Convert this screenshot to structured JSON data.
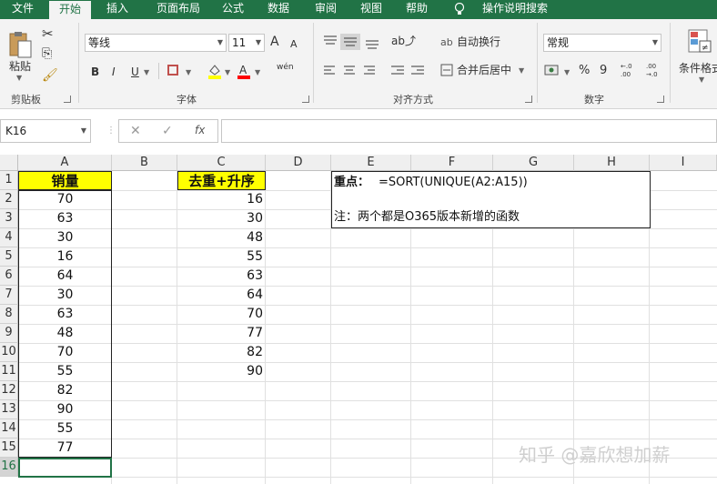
{
  "ribbon_tabs": [
    "文件",
    "开始",
    "插入",
    "页面布局",
    "公式",
    "数据",
    "审阅",
    "视图",
    "帮助",
    "操作说明搜索"
  ],
  "clipboard": {
    "paste": "粘贴",
    "group": "剪贴板"
  },
  "font": {
    "name": "等线",
    "size": "11",
    "bold": "B",
    "italic": "I",
    "underline": "U",
    "grow": "A",
    "shrink": "A",
    "phonetic": "wén",
    "group": "字体"
  },
  "alignment": {
    "wrap": "自动换行",
    "merge": "合并后居中",
    "group": "对齐方式"
  },
  "number": {
    "format": "常规",
    "percent": "%",
    "comma": "9",
    "inc": "←.0 .00",
    "dec": ".00 →.0",
    "group": "数字"
  },
  "styles": {
    "conditional": "条件格式"
  },
  "name_box": "K16",
  "formula_icons": {
    "cancel": "✕",
    "enter": "✓",
    "fx": "fx"
  },
  "columns": [
    "A",
    "B",
    "C",
    "D",
    "E",
    "F",
    "G",
    "H",
    "I"
  ],
  "rows": [
    "1",
    "2",
    "3",
    "4",
    "5",
    "6",
    "7",
    "8",
    "9",
    "10",
    "11",
    "12",
    "13",
    "14",
    "15",
    "16"
  ],
  "col_a_header": "销量",
  "col_a_values": [
    "70",
    "63",
    "30",
    "16",
    "64",
    "30",
    "63",
    "48",
    "70",
    "55",
    "82",
    "90",
    "55",
    "77"
  ],
  "col_c_header": "去重+升序",
  "col_c_values": [
    "16",
    "30",
    "48",
    "55",
    "63",
    "64",
    "70",
    "77",
    "82",
    "90"
  ],
  "note": {
    "label": "重点：",
    "formula": "=SORT(UNIQUE(A2:A15))",
    "remark": "注：两个都是O365版本新增的函数"
  },
  "watermark": "知乎 @嘉欣想加薪"
}
